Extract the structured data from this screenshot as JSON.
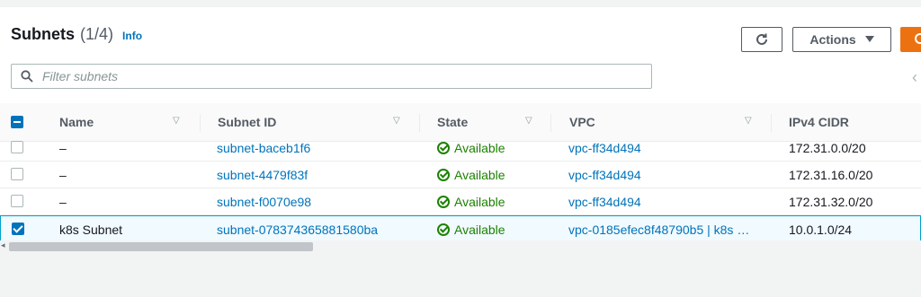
{
  "header": {
    "title": "Subnets",
    "count": "(1/4)",
    "info_label": "Info",
    "actions_label": "Actions"
  },
  "search": {
    "placeholder": "Filter subnets"
  },
  "columns": [
    "Name",
    "Subnet ID",
    "State",
    "VPC",
    "IPv4 CIDR"
  ],
  "rows": [
    {
      "checked": false,
      "name": "–",
      "subnet_id": "subnet-baceb1f6",
      "state": "Available",
      "vpc": "vpc-ff34d494",
      "cidr": "172.31.0.0/20"
    },
    {
      "checked": false,
      "name": "–",
      "subnet_id": "subnet-4479f83f",
      "state": "Available",
      "vpc": "vpc-ff34d494",
      "cidr": "172.31.16.0/20"
    },
    {
      "checked": false,
      "name": "–",
      "subnet_id": "subnet-f0070e98",
      "state": "Available",
      "vpc": "vpc-ff34d494",
      "cidr": "172.31.32.0/20"
    },
    {
      "checked": true,
      "name": "k8s Subnet",
      "subnet_id": "subnet-07837436588158​0ba",
      "state": "Available",
      "vpc": "vpc-0185efec8f48790b5 | k8s …",
      "cidr": "10.0.1.0/24"
    }
  ],
  "colors": {
    "link": "#0073bb",
    "available": "#1d8102",
    "primary_button": "#ec7211",
    "selected_row": "#f1faff"
  },
  "icons": {
    "refresh": "refresh-icon",
    "dropdown": "caret-down-icon",
    "search": "search-icon",
    "status": "check-circle-icon"
  }
}
